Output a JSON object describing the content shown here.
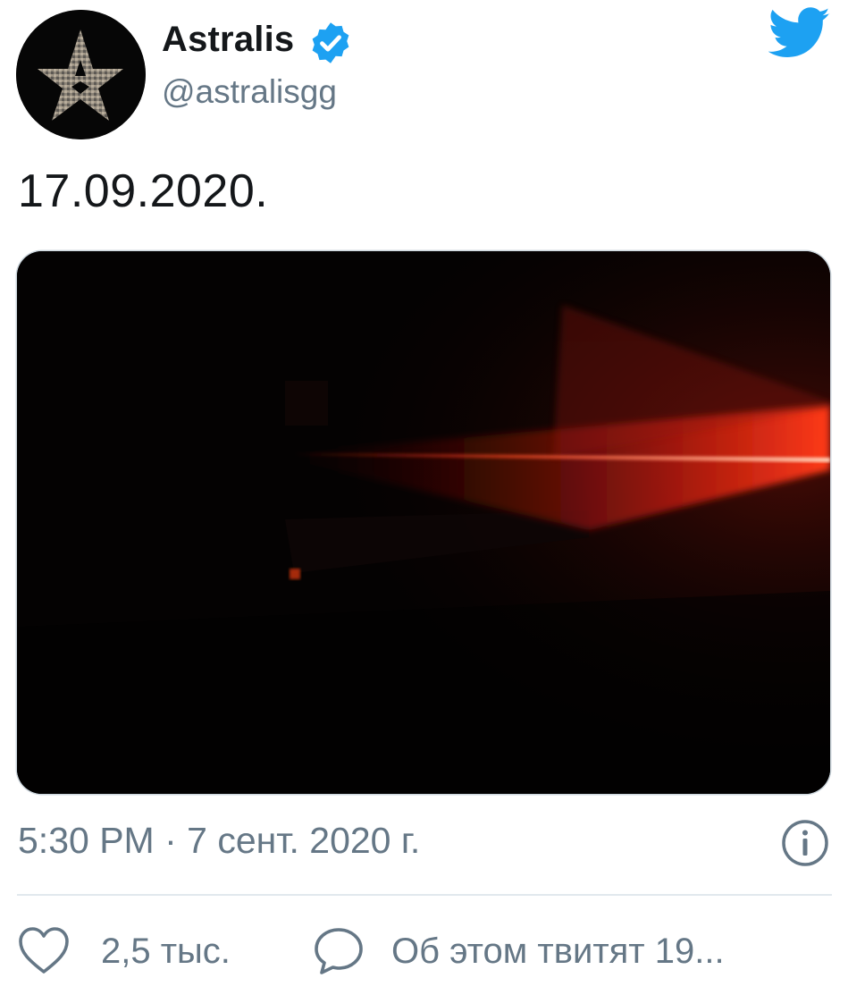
{
  "author": {
    "display_name": "Astralis",
    "handle": "@astralisgg",
    "verified": true,
    "avatar_icon": "astralis-star-logo",
    "verified_icon": "verified-badge-icon"
  },
  "brand": {
    "icon": "twitter-bird-icon",
    "color": "#1da1f2"
  },
  "tweet": {
    "text": "17.09.2020.",
    "media": {
      "description_icon": "dark-room-red-laser-photo"
    },
    "timestamp": "5:30 PM · 7 сент. 2020 г.",
    "info_icon": "info-icon"
  },
  "actions": {
    "likes": {
      "icon": "heart-icon",
      "count": "2,5 тыс."
    },
    "conversation": {
      "icon": "speech-bubble-icon",
      "label": "Об этом твитят 19..."
    }
  },
  "colors": {
    "text_primary": "#14171a",
    "text_secondary": "#657786",
    "divider": "#e1e8ed",
    "verified_blue": "#1da1f2",
    "laser_red": "#ff3a1a"
  }
}
